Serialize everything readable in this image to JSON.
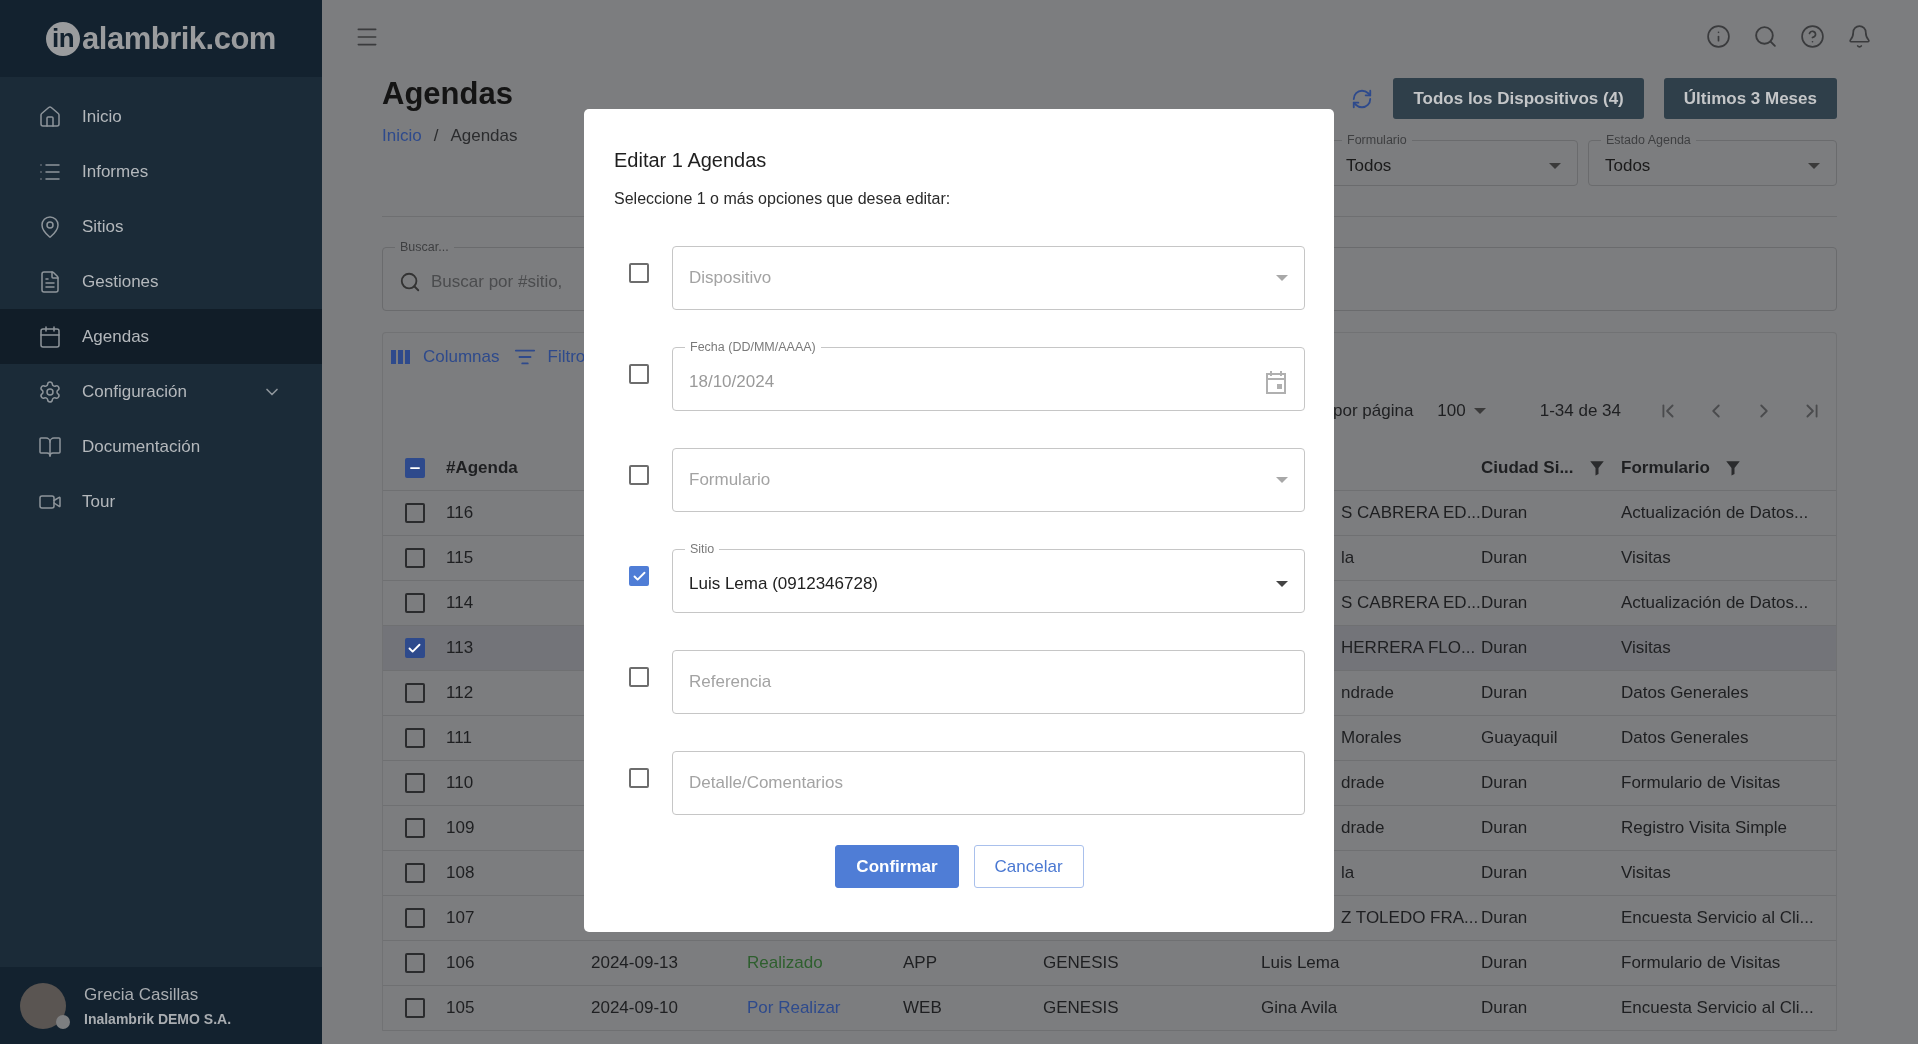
{
  "sidebar": {
    "logo": {
      "mark": "in",
      "text": "alambrik.com"
    },
    "items": [
      {
        "label": "Inicio",
        "selected": false
      },
      {
        "label": "Informes",
        "selected": false
      },
      {
        "label": "Sitios",
        "selected": false
      },
      {
        "label": "Gestiones",
        "selected": false
      },
      {
        "label": "Agendas",
        "selected": true
      },
      {
        "label": "Configuración",
        "selected": false,
        "expanded": false
      },
      {
        "label": "Documentación",
        "selected": false
      },
      {
        "label": "Tour",
        "selected": false
      }
    ],
    "user": {
      "name": "Grecia Casillas",
      "company": "Inalambrik DEMO S.A."
    }
  },
  "page": {
    "title": "Agendas",
    "breadcrumb_separator": "/",
    "breadcrumb": [
      {
        "label": "Inicio",
        "kind": "link"
      },
      {
        "label": "Agendas",
        "kind": "current"
      }
    ],
    "actions": [
      "Todos los Dispositivos (4)",
      "Últimos 3 Meses"
    ],
    "filters": [
      {
        "label": "Formulario",
        "value": "Todos"
      },
      {
        "label": "Estado Agenda",
        "value": "Todos"
      }
    ],
    "search": {
      "label": "Buscar...",
      "placeholder": "Buscar por #sitio,"
    }
  },
  "table": {
    "toolbar": [
      "Columnas",
      "Filtro"
    ],
    "rows_per_page_label": "por página",
    "rows_per_page": "100",
    "range": "1-34 de 34",
    "header_checkbox": {
      "indeterminate": true
    },
    "columns": [
      {
        "label": "#Agenda",
        "filter": false
      },
      {
        "label": "Ciudad Si...",
        "filter": true
      },
      {
        "label": "Formulario",
        "filter": true
      }
    ],
    "rows": [
      {
        "id": "116",
        "selected": false,
        "site": "S CABRERA ED...",
        "city": "Duran",
        "form": "Actualización de Datos..."
      },
      {
        "id": "115",
        "selected": false,
        "site": "la",
        "city": "Duran",
        "form": "Visitas"
      },
      {
        "id": "114",
        "selected": false,
        "site": "S CABRERA ED...",
        "city": "Duran",
        "form": "Actualización de Datos..."
      },
      {
        "id": "113",
        "selected": true,
        "site": "HERRERA FLO...",
        "city": "Duran",
        "form": "Visitas"
      },
      {
        "id": "112",
        "selected": false,
        "site": "ndrade",
        "city": "Duran",
        "form": "Datos Generales"
      },
      {
        "id": "111",
        "selected": false,
        "site": "Morales",
        "city": "Guayaquil",
        "form": "Datos Generales"
      },
      {
        "id": "110",
        "selected": false,
        "site": "drade",
        "city": "Duran",
        "form": "Formulario de Visitas"
      },
      {
        "id": "109",
        "selected": false,
        "site": "drade",
        "city": "Duran",
        "form": "Registro Visita Simple"
      },
      {
        "id": "108",
        "selected": false,
        "site": "la",
        "city": "Duran",
        "form": "Visitas"
      },
      {
        "id": "107",
        "selected": false,
        "site": "Z TOLEDO FRA...",
        "city": "Duran",
        "form": "Encuesta Servicio al Cli..."
      },
      {
        "id": "106",
        "selected": false,
        "date": "2024-09-13",
        "status": {
          "text": "Realizado",
          "color": "#2e5f2e"
        },
        "channel": "APP",
        "company": "GENESIS",
        "site": "Luis Lema",
        "city": "Duran",
        "form": "Formulario de Visitas"
      },
      {
        "id": "105",
        "selected": false,
        "date": "2024-09-10",
        "status": {
          "text": "Por Realizar",
          "color": "#2e4a8c"
        },
        "channel": "WEB",
        "company": "GENESIS",
        "site": "Gina Avila",
        "city": "Duran",
        "form": "Encuesta Servicio al Cli..."
      }
    ]
  },
  "modal": {
    "title": "Editar 1 Agendas",
    "prompt": "Seleccione 1 o más opciones que desea editar:",
    "fields": [
      {
        "kind": "select",
        "checked": false,
        "placeholder": "Dispositivo"
      },
      {
        "kind": "date",
        "checked": false,
        "label": "Fecha (DD/MM/AAAA)",
        "value": "18/10/2024"
      },
      {
        "kind": "select",
        "checked": false,
        "placeholder": "Formulario"
      },
      {
        "kind": "select",
        "checked": true,
        "label": "Sitio",
        "value": "Luis Lema (0912346728)"
      },
      {
        "kind": "text",
        "checked": false,
        "placeholder": "Referencia"
      },
      {
        "kind": "text",
        "checked": false,
        "placeholder": "Detalle/Comentarios"
      }
    ],
    "buttons": [
      {
        "label": "Confirmar",
        "kind": "primary"
      },
      {
        "label": "Cancelar",
        "kind": "secondary"
      }
    ]
  }
}
